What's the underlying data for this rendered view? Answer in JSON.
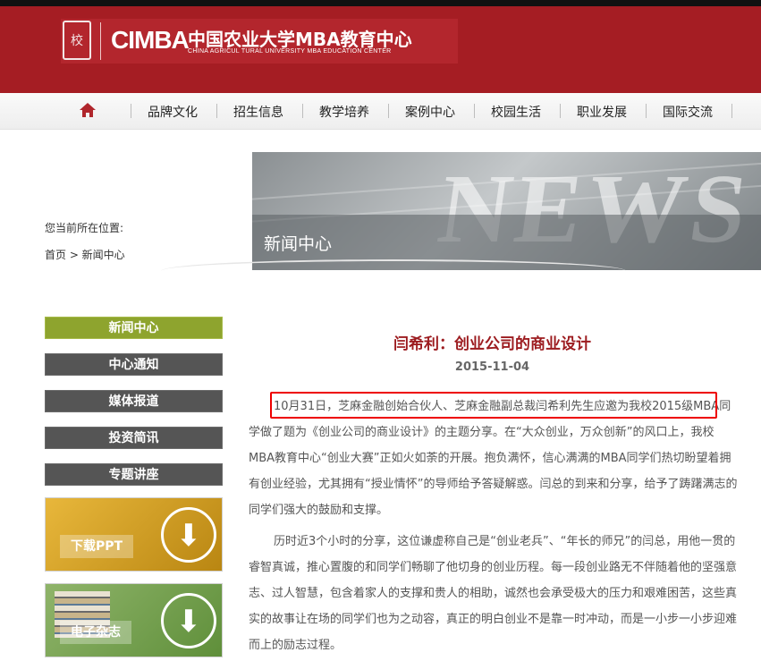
{
  "header": {
    "logo_cn": "中国农业大学MBA教育中心",
    "logo_en": "CHINA AGRICUL TURAL UNIVERSITY  MBA EDUCATION CENTER",
    "mba_mark": "CIMBA",
    "accent": "#a51d23"
  },
  "nav": {
    "home_icon": "home-icon",
    "items": [
      "品牌文化",
      "招生信息",
      "教学培养",
      "案例中心",
      "校园生活",
      "职业发展",
      "国际交流"
    ]
  },
  "breadcrumb": {
    "label": "您当前所在位置:",
    "path": "首页 > 新闻中心"
  },
  "banner": {
    "title": "新闻中心",
    "bg_word": "NEWS"
  },
  "sidebar": {
    "items": [
      "新闻中心",
      "中心通知",
      "媒体报道",
      "投资简讯",
      "专题讲座"
    ],
    "active_color": "#8ea42e",
    "promos": [
      "下载PPT",
      "电子杂志"
    ]
  },
  "article": {
    "title": "闫希利：创业公司的商业设计",
    "date": "2015-11-04",
    "p1": "10月31日，芝麻金融创始合伙人、芝麻金融副总裁闫希利先生应邀为我校2015级MBA同学做了题为《创业公司的商业设计》的主题分享。在“大众创业，万众创新”的风口上，我校MBA教育中心“创业大赛”正如火如荼的开展。抱负满怀，信心满满的MBA同学们热切盼望着拥有创业经验，尤其拥有“授业情怀”的导师给予答疑解惑。闫总的到来和分享，给予了踌躇满志的同学们强大的鼓励和支撑。",
    "p2": "历时近3个小时的分享，这位谦虚称自己是“创业老兵”、“年长的师兄”的闫总，用他一贯的睿智真诚，推心置腹的和同学们畅聊了他切身的创业历程。每一段创业路无不伴随着他的坚强意志、过人智慧，包含着家人的支撑和贵人的相助，诚然也会承受极大的压力和艰难困苦，这些真实的故事让在场的同学们也为之动容，真正的明白创业不是靠一时冲动，而是一小步一小步迎难而上的励志过程。"
  }
}
